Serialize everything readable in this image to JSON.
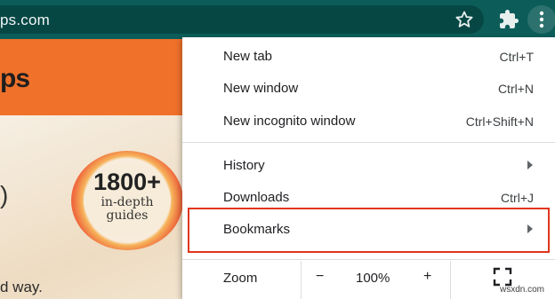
{
  "browser": {
    "url_fragment": "ps.com",
    "icons": {
      "bookmark": "star-icon",
      "extensions": "puzzle-icon",
      "menu": "kebab-icon"
    }
  },
  "page": {
    "logo_fragment": "ps",
    "hero_fragment_top": ")",
    "hero_fragment_bottom": "d way.",
    "badge": {
      "number": "1800+",
      "line1": "in-depth",
      "line2": "guides"
    }
  },
  "menu": {
    "new_tab": {
      "label": "New tab",
      "shortcut": "Ctrl+T"
    },
    "new_window": {
      "label": "New window",
      "shortcut": "Ctrl+N"
    },
    "incognito": {
      "label": "New incognito window",
      "shortcut": "Ctrl+Shift+N"
    },
    "history": {
      "label": "History"
    },
    "downloads": {
      "label": "Downloads",
      "shortcut": "Ctrl+J"
    },
    "bookmarks": {
      "label": "Bookmarks"
    },
    "zoom": {
      "label": "Zoom",
      "minus": "−",
      "level": "100%",
      "plus": "+"
    }
  },
  "watermark": "wsxdn.com",
  "colors": {
    "toolbar": "#0c5d5a",
    "banner": "#f0712a",
    "highlight": "#e0351e"
  }
}
